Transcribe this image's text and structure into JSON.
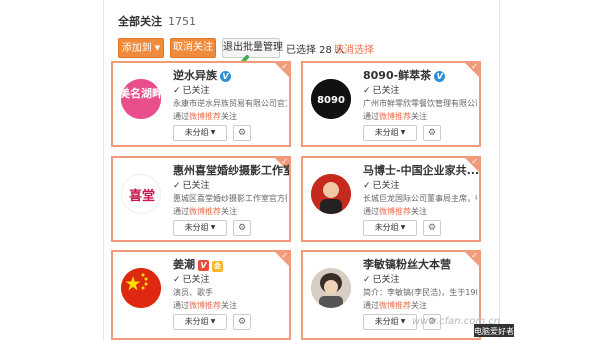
{
  "header": {
    "title": "全部关注",
    "count": "1751"
  },
  "toolbar": {
    "add_label": "添加到",
    "unfollow_label": "取消关注",
    "exit_batch_label": "退出批量管理",
    "selected_text": "已选择 28 人",
    "cancel_select_label": "取消选择"
  },
  "cards": [
    {
      "name": "逆水异族",
      "followed": "已关注",
      "desc": "永康市逆水异族贸易有限公司官方...",
      "via_prefix": "通过",
      "via_link": "微博推荐",
      "via_suffix": "关注",
      "group": "未分组",
      "avatar_text": "美名湖畔",
      "badge": "V"
    },
    {
      "name": "8090-鲜萃茶",
      "followed": "已关注",
      "desc": "广州市鲜零欣零餐饮管理有限公司",
      "via_prefix": "通过",
      "via_link": "微博推荐",
      "via_suffix": "关注",
      "group": "未分组",
      "avatar_text": "8090",
      "badge": "V"
    },
    {
      "name": "惠州喜堂婚纱摄影工作室",
      "followed": "已关注",
      "desc": "惠城区喜堂婚纱摄影工作室官方微博",
      "via_prefix": "通过",
      "via_link": "微博推荐",
      "via_suffix": "关注",
      "group": "未分组",
      "avatar_text": "喜堂",
      "badge": "V"
    },
    {
      "name": "马博士-中国企业家共...",
      "followed": "已关注",
      "desc": "长城巨龙国际公司董事局主席，中...",
      "via_prefix": "通过",
      "via_link": "微博推荐",
      "via_suffix": "关注",
      "group": "未分组",
      "avatar_text": "",
      "badge": "V"
    },
    {
      "name": "姜潮",
      "followed": "已关注",
      "desc": "演员、歌手",
      "via_prefix": "通过",
      "via_link": "微博推荐",
      "via_suffix": "关注",
      "group": "未分组",
      "avatar_text": "",
      "badge": "V",
      "vip": "会"
    },
    {
      "name": "李敏镐粉丝大本营",
      "followed": "已关注",
      "desc": "简介：李敏镐(李民浩)，生于1987...",
      "via_prefix": "通过",
      "via_link": "微博推荐",
      "via_suffix": "关注",
      "group": "未分组",
      "avatar_text": ""
    }
  ],
  "watermark": {
    "text": "www.cfan.com.cn",
    "label": "电脑爱好者"
  },
  "colors": {
    "accent": "#f08a3c",
    "card_border": "#f29b7a",
    "link": "#eb7350",
    "verified": "#2d8fd8"
  }
}
